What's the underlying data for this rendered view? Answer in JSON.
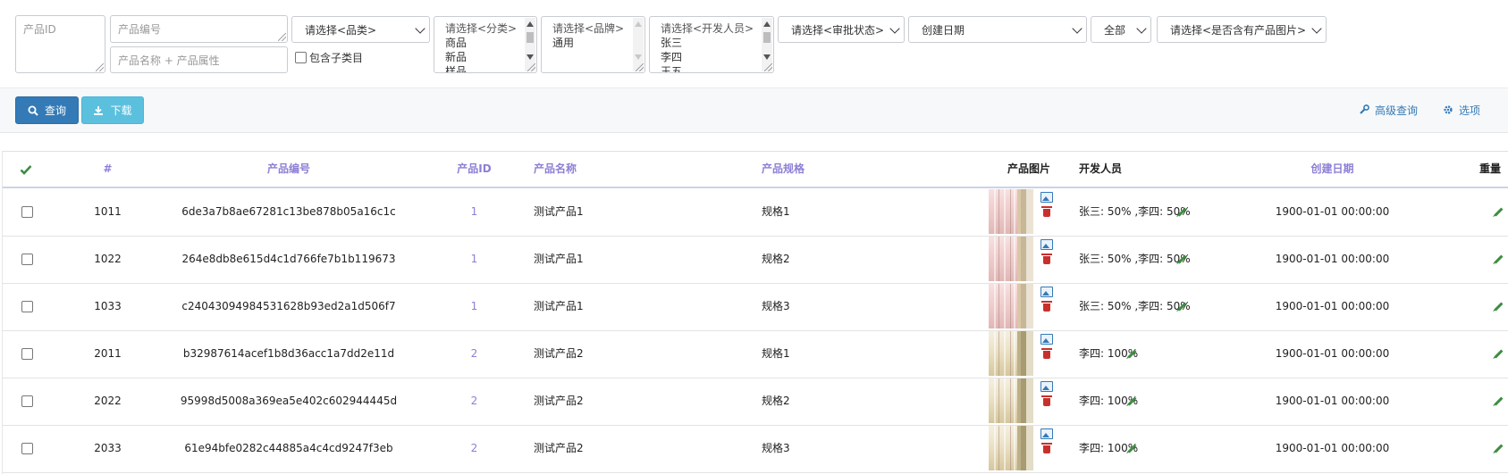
{
  "filters": {
    "product_id_placeholder": "产品ID",
    "product_code_placeholder": "产品编号",
    "product_name_placeholder": "产品名称 + 产品属性",
    "category_select": "请选择<品类>",
    "include_subcategory_label": "包含子类目",
    "classification_list": [
      "请选择<分类>",
      "商品",
      "新品",
      "样品"
    ],
    "brand_list": [
      "请选择<品牌>",
      "通用"
    ],
    "developer_list": [
      "请选择<开发人员>",
      "张三",
      "李四",
      "王五"
    ],
    "approval_select": "请选择<审批状态>",
    "date_type_select": "创建日期",
    "range_select": "全部",
    "has_image_select": "请选择<是否含有产品图片>"
  },
  "toolbar": {
    "query_label": "查询",
    "download_label": "下载",
    "advanced_query_label": "高级查询",
    "options_label": "选项"
  },
  "table": {
    "headers": {
      "index": "#",
      "product_code": "产品编号",
      "product_id": "产品ID",
      "product_name": "产品名称",
      "product_spec": "产品规格",
      "product_image": "产品图片",
      "developer": "开发人员",
      "created_date": "创建日期",
      "weight": "重量"
    },
    "rows": [
      {
        "index": "1011",
        "code": "6de3a7b8ae67281c13be878b05a16c1c",
        "pid": "1",
        "name": "测试产品1",
        "spec": "规格1",
        "developer": "张三: 50% ,李四: 50%",
        "date": "1900-01-01 00:00:00",
        "image": "pink"
      },
      {
        "index": "1022",
        "code": "264e8db8e615d4c1d766fe7b1b119673",
        "pid": "1",
        "name": "测试产品1",
        "spec": "规格2",
        "developer": "张三: 50% ,李四: 50%",
        "date": "1900-01-01 00:00:00",
        "image": "pink"
      },
      {
        "index": "1033",
        "code": "c24043094984531628b93ed2a1d506f7",
        "pid": "1",
        "name": "测试产品1",
        "spec": "规格3",
        "developer": "张三: 50% ,李四: 50%",
        "date": "1900-01-01 00:00:00",
        "image": "pink"
      },
      {
        "index": "2011",
        "code": "b32987614acef1b8d36acc1a7dd2e11d",
        "pid": "2",
        "name": "测试产品2",
        "spec": "规格1",
        "developer": "李四: 100%",
        "date": "1900-01-01 00:00:00",
        "image": "cream"
      },
      {
        "index": "2022",
        "code": "95998d5008a369ea5e402c602944445d",
        "pid": "2",
        "name": "测试产品2",
        "spec": "规格2",
        "developer": "李四: 100%",
        "date": "1900-01-01 00:00:00",
        "image": "cream"
      },
      {
        "index": "2033",
        "code": "61e94bfe0282c44885a4c4cd9247f3eb",
        "pid": "2",
        "name": "测试产品2",
        "spec": "规格3",
        "developer": "李四: 100%",
        "date": "1900-01-01 00:00:00",
        "image": "cream"
      }
    ]
  },
  "colors": {
    "primary": "#337ab7",
    "info": "#5bc0de",
    "header_link": "#8e7fd6",
    "check_green": "#3c8d40",
    "danger": "#c9302c"
  }
}
